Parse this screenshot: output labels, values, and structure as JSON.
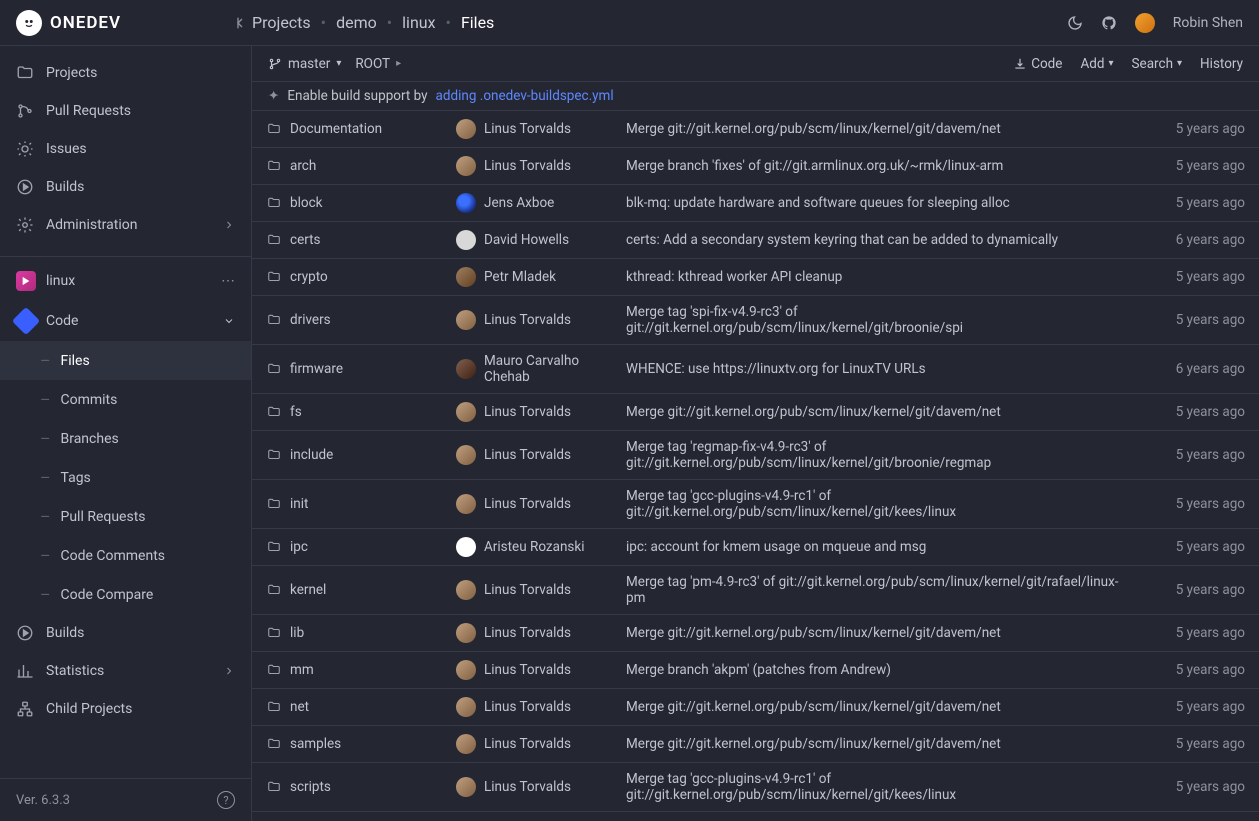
{
  "brand": "ONEDEV",
  "breadcrumb": [
    "Projects",
    "demo",
    "linux",
    "Files"
  ],
  "user": "Robin Shen",
  "sidebar": {
    "top": [
      {
        "label": "Projects",
        "icon": "folder"
      },
      {
        "label": "Pull Requests",
        "icon": "merge"
      },
      {
        "label": "Issues",
        "icon": "bug"
      },
      {
        "label": "Builds",
        "icon": "play"
      },
      {
        "label": "Administration",
        "icon": "gear",
        "caret": true
      }
    ],
    "project": "linux",
    "code_section": "Code",
    "code_children": [
      {
        "label": "Files",
        "active": true
      },
      {
        "label": "Commits"
      },
      {
        "label": "Branches"
      },
      {
        "label": "Tags"
      },
      {
        "label": "Pull Requests"
      },
      {
        "label": "Code Comments"
      },
      {
        "label": "Code Compare"
      }
    ],
    "bottom": [
      {
        "label": "Builds",
        "icon": "play"
      },
      {
        "label": "Statistics",
        "icon": "chart",
        "caret": true
      },
      {
        "label": "Child Projects",
        "icon": "tree"
      }
    ],
    "version": "Ver. 6.3.3"
  },
  "toolbar": {
    "branch": "master",
    "root": "ROOT",
    "code": "Code",
    "add": "Add",
    "search": "Search",
    "history": "History"
  },
  "infobar": {
    "prefix": "Enable build support by",
    "link": "adding .onedev-buildspec.yml"
  },
  "files": [
    {
      "name": "Documentation",
      "author": "Linus Torvalds",
      "av": "lt",
      "msg": "Merge git://git.kernel.org/pub/scm/linux/kernel/git/davem/net",
      "time": "5 years ago"
    },
    {
      "name": "arch",
      "author": "Linus Torvalds",
      "av": "lt",
      "msg": "Merge branch 'fixes' of git://git.armlinux.org.uk/~rmk/linux-arm",
      "time": "5 years ago"
    },
    {
      "name": "block",
      "author": "Jens Axboe",
      "av": "ja",
      "msg": "blk-mq: update hardware and software queues for sleeping alloc",
      "time": "5 years ago"
    },
    {
      "name": "certs",
      "author": "David Howells",
      "av": "dh",
      "msg": "certs: Add a secondary system keyring that can be added to dynamically",
      "time": "6 years ago"
    },
    {
      "name": "crypto",
      "author": "Petr Mladek",
      "av": "pm",
      "msg": "kthread: kthread worker API cleanup",
      "time": "5 years ago"
    },
    {
      "name": "drivers",
      "author": "Linus Torvalds",
      "av": "lt",
      "msg": "Merge tag 'spi-fix-v4.9-rc3' of git://git.kernel.org/pub/scm/linux/kernel/git/broonie/spi",
      "time": "5 years ago"
    },
    {
      "name": "firmware",
      "author": "Mauro Carvalho Chehab",
      "av": "mc",
      "msg": "WHENCE: use https://linuxtv.org for LinuxTV URLs",
      "time": "6 years ago"
    },
    {
      "name": "fs",
      "author": "Linus Torvalds",
      "av": "lt",
      "msg": "Merge git://git.kernel.org/pub/scm/linux/kernel/git/davem/net",
      "time": "5 years ago"
    },
    {
      "name": "include",
      "author": "Linus Torvalds",
      "av": "lt",
      "msg": "Merge tag 'regmap-fix-v4.9-rc3' of git://git.kernel.org/pub/scm/linux/kernel/git/broonie/regmap",
      "time": "5 years ago"
    },
    {
      "name": "init",
      "author": "Linus Torvalds",
      "av": "lt",
      "msg": "Merge tag 'gcc-plugins-v4.9-rc1' of git://git.kernel.org/pub/scm/linux/kernel/git/kees/linux",
      "time": "5 years ago"
    },
    {
      "name": "ipc",
      "author": "Aristeu Rozanski",
      "av": "ar",
      "msg": "ipc: account for kmem usage on mqueue and msg",
      "time": "5 years ago"
    },
    {
      "name": "kernel",
      "author": "Linus Torvalds",
      "av": "lt",
      "msg": "Merge tag 'pm-4.9-rc3' of git://git.kernel.org/pub/scm/linux/kernel/git/rafael/linux-pm",
      "time": "5 years ago"
    },
    {
      "name": "lib",
      "author": "Linus Torvalds",
      "av": "lt",
      "msg": "Merge git://git.kernel.org/pub/scm/linux/kernel/git/davem/net",
      "time": "5 years ago"
    },
    {
      "name": "mm",
      "author": "Linus Torvalds",
      "av": "lt",
      "msg": "Merge branch 'akpm' (patches from Andrew)",
      "time": "5 years ago"
    },
    {
      "name": "net",
      "author": "Linus Torvalds",
      "av": "lt",
      "msg": "Merge git://git.kernel.org/pub/scm/linux/kernel/git/davem/net",
      "time": "5 years ago"
    },
    {
      "name": "samples",
      "author": "Linus Torvalds",
      "av": "lt",
      "msg": "Merge git://git.kernel.org/pub/scm/linux/kernel/git/davem/net",
      "time": "5 years ago"
    },
    {
      "name": "scripts",
      "author": "Linus Torvalds",
      "av": "lt",
      "msg": "Merge tag 'gcc-plugins-v4.9-rc1' of git://git.kernel.org/pub/scm/linux/kernel/git/kees/linux",
      "time": "5 years ago"
    }
  ]
}
